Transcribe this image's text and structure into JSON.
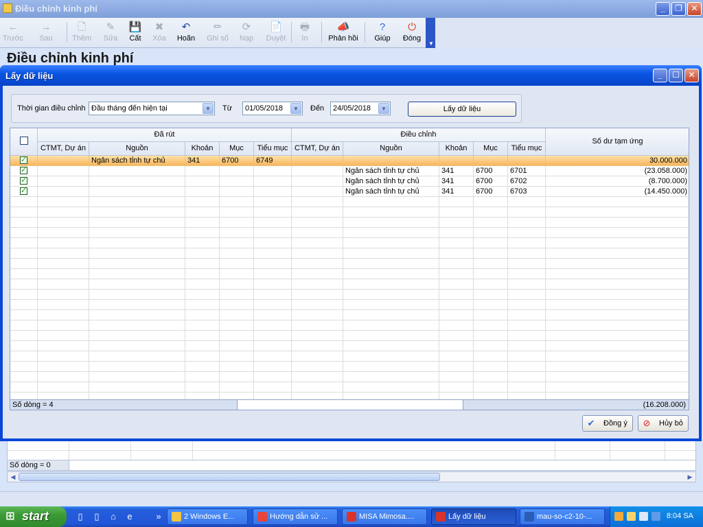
{
  "main_window": {
    "title": "Điều chỉnh kinh phí",
    "heading": "Điều chỉnh kinh phí",
    "min_glyph": "_",
    "max_glyph": "❐",
    "close_glyph": "✕",
    "status_count": "Số dòng = 0"
  },
  "toolbar": [
    {
      "id": "back",
      "label": "Trước",
      "icon": "←",
      "icon_name": "arrow-left-icon",
      "enabled": false
    },
    {
      "id": "next",
      "label": "Sau",
      "icon": "→",
      "icon_name": "arrow-right-icon",
      "enabled": false
    },
    {
      "id": "add",
      "label": "Thêm",
      "icon": "🗋",
      "icon_name": "add-document-icon",
      "enabled": false
    },
    {
      "id": "edit",
      "label": "Sửa",
      "icon": "✎",
      "icon_name": "edit-document-icon",
      "enabled": false
    },
    {
      "id": "save",
      "label": "Cất",
      "icon": "💾",
      "icon_name": "save-icon",
      "enabled": true
    },
    {
      "id": "delete",
      "label": "Xóa",
      "icon": "✖",
      "icon_name": "delete-icon",
      "enabled": false
    },
    {
      "id": "undo",
      "label": "Hoãn",
      "icon": "↶",
      "icon_name": "undo-icon",
      "enabled": true
    },
    {
      "id": "post",
      "label": "Ghi sổ",
      "icon": "✏",
      "icon_name": "pencil-icon",
      "enabled": false
    },
    {
      "id": "load",
      "label": "Nạp",
      "icon": "⟳",
      "icon_name": "load-icon",
      "enabled": false
    },
    {
      "id": "approve",
      "label": "Duyệt",
      "icon": "📄",
      "icon_name": "approve-icon",
      "enabled": false
    },
    {
      "id": "print",
      "label": "In",
      "icon": "🖶",
      "icon_name": "print-icon",
      "enabled": false
    },
    {
      "id": "feedback",
      "label": "Phản hồi",
      "icon": "📣",
      "icon_name": "megaphone-icon",
      "enabled": true
    },
    {
      "id": "help",
      "label": "Giúp",
      "icon": "?",
      "icon_name": "help-icon",
      "enabled": true
    },
    {
      "id": "close",
      "label": "Đóng",
      "icon": "⏻",
      "icon_name": "power-close-icon",
      "enabled": true
    }
  ],
  "dialog": {
    "title": "Lấy dữ liệu",
    "filter": {
      "period_label": "Thời gian điều chỉnh",
      "period_value": "Đầu tháng đến hiện tại",
      "from_label": "Từ",
      "from_value": "01/05/2018",
      "to_label": "Đến",
      "to_value": "24/05/2018",
      "fetch_button": "Lấy dữ liệu"
    },
    "grid": {
      "group_withdrawn": "Đã rút",
      "group_adjust": "Điều chỉnh",
      "balance_header": "Số dư tạm ứng",
      "sub_headers": [
        "CTMT, Dự án",
        "Nguồn",
        "Khoản",
        "Mục",
        "Tiểu mục",
        "CTMT, Dự án",
        "Nguồn",
        "Khoản",
        "Mục",
        "Tiểu mục"
      ],
      "rows": [
        {
          "checked": true,
          "selected": true,
          "w_project": "",
          "w_source": "Ngân sách tỉnh  tự chủ",
          "w_khoan": "341",
          "w_muc": "6700",
          "w_tieumuc": "6749",
          "a_project": "",
          "a_source": "",
          "a_khoan": "",
          "a_muc": "",
          "a_tieumuc": "",
          "balance": "30.000.000"
        },
        {
          "checked": true,
          "selected": false,
          "w_project": "",
          "w_source": "",
          "w_khoan": "",
          "w_muc": "",
          "w_tieumuc": "",
          "a_project": "",
          "a_source": "Ngân sách tỉnh  tự chủ",
          "a_khoan": "341",
          "a_muc": "6700",
          "a_tieumuc": "6701",
          "balance": "(23.058.000)"
        },
        {
          "checked": true,
          "selected": false,
          "w_project": "",
          "w_source": "",
          "w_khoan": "",
          "w_muc": "",
          "w_tieumuc": "",
          "a_project": "",
          "a_source": "Ngân sách tỉnh  tự chủ",
          "a_khoan": "341",
          "a_muc": "6700",
          "a_tieumuc": "6702",
          "balance": "(8.700.000)"
        },
        {
          "checked": true,
          "selected": false,
          "w_project": "",
          "w_source": "",
          "w_khoan": "",
          "w_muc": "",
          "w_tieumuc": "",
          "a_project": "",
          "a_source": "Ngân sách tỉnh  tự chủ",
          "a_khoan": "341",
          "a_muc": "6700",
          "a_tieumuc": "6703",
          "balance": "(14.450.000)"
        }
      ],
      "row_count": "Số dòng = 4",
      "total": "(16.208.000)"
    },
    "ok_button": "Đồng ý",
    "cancel_button": "Hủy bỏ"
  },
  "taskbar": {
    "start_label": "start",
    "tasks": [
      {
        "label": "2 Windows E...",
        "icon_name": "folder-icon",
        "color": "#f4c542",
        "active": false
      },
      {
        "label": "Hướng dẫn sử ...",
        "icon_name": "chrome-icon",
        "color": "#e8453c",
        "active": false
      },
      {
        "label": "MISA Mimosa....",
        "icon_name": "misa-icon",
        "color": "#d9342b",
        "active": false
      },
      {
        "label": "Lấy dữ liệu",
        "icon_name": "misa-icon",
        "color": "#d9342b",
        "active": true
      },
      {
        "label": "mau-so-c2-10-...",
        "icon_name": "word-icon",
        "color": "#2b5cb8",
        "active": false
      }
    ],
    "clock": "8:04 SA"
  },
  "colors": {
    "dialog_frame": "#0a47d6",
    "selected_row": "#f8b35a",
    "taskbar": "#245edb",
    "start_button": "#3c9a36"
  }
}
